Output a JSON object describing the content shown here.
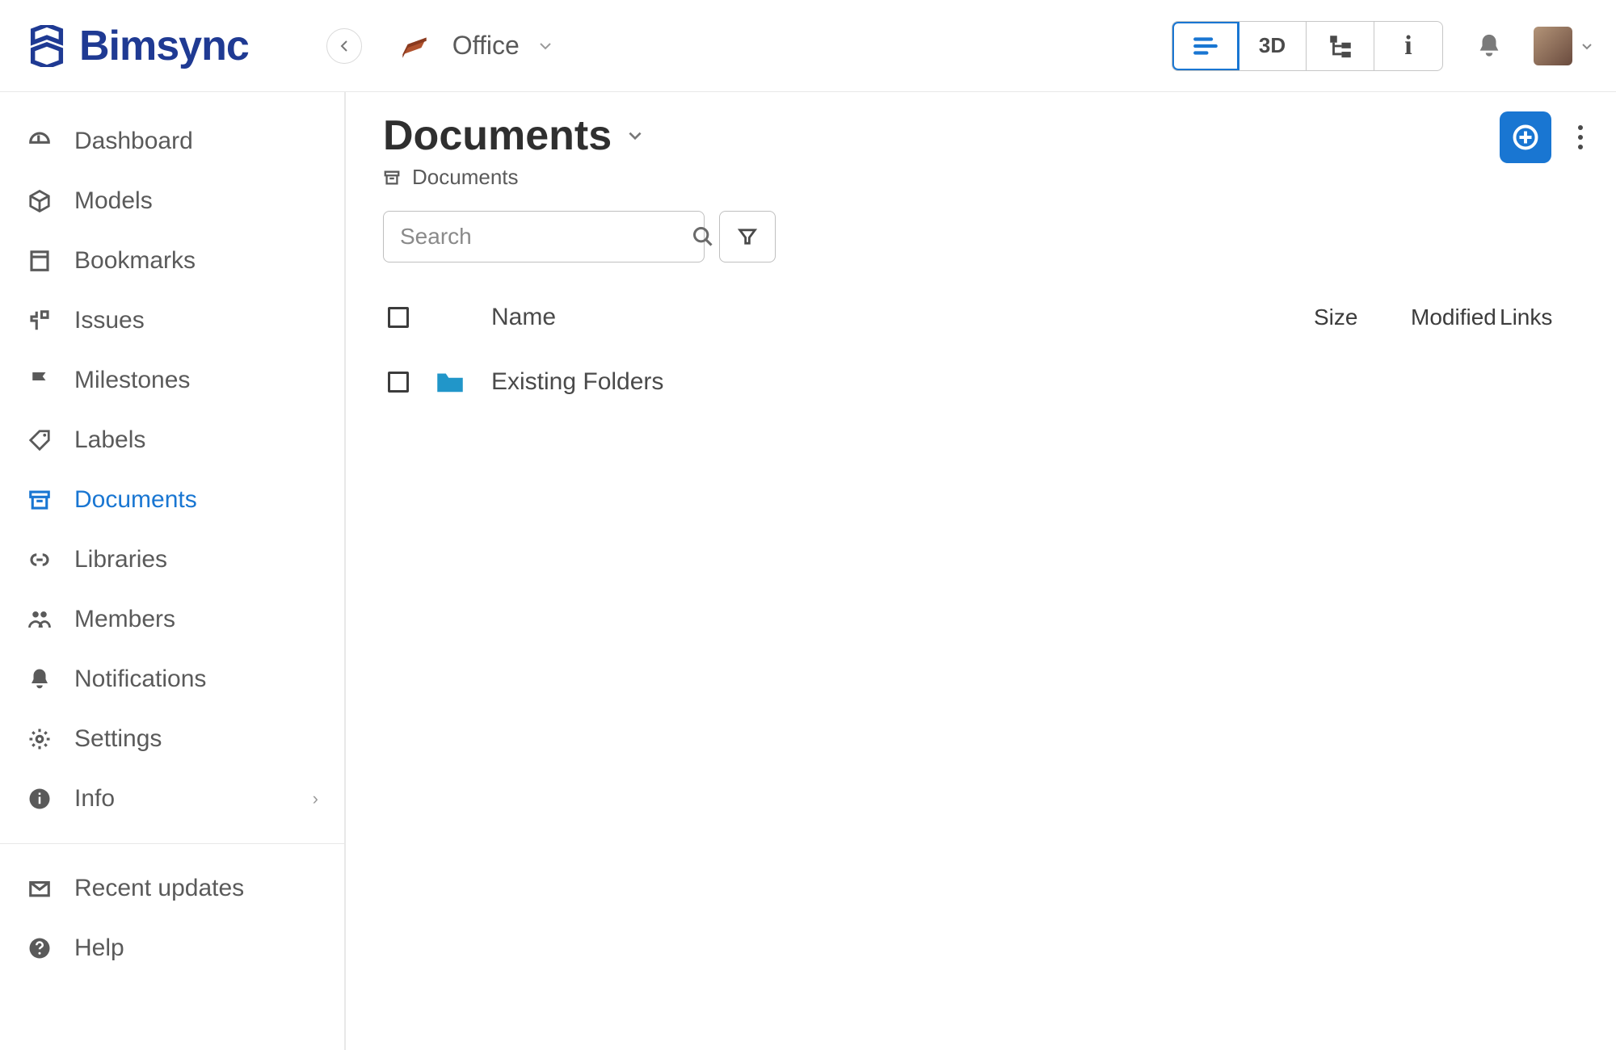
{
  "brand": "Bimsync",
  "project": {
    "name": "Office"
  },
  "view_tabs": {
    "list": "",
    "three_d": "3D",
    "tree": "",
    "info": "i"
  },
  "sidebar": {
    "items": [
      {
        "label": "Dashboard",
        "icon": "dashboard-icon"
      },
      {
        "label": "Models",
        "icon": "cube-icon"
      },
      {
        "label": "Bookmarks",
        "icon": "bookmark-icon"
      },
      {
        "label": "Issues",
        "icon": "issue-icon"
      },
      {
        "label": "Milestones",
        "icon": "flag-icon"
      },
      {
        "label": "Labels",
        "icon": "tag-icon"
      },
      {
        "label": "Documents",
        "icon": "archive-icon",
        "active": true
      },
      {
        "label": "Libraries",
        "icon": "link-icon"
      },
      {
        "label": "Members",
        "icon": "people-icon"
      },
      {
        "label": "Notifications",
        "icon": "bell-icon"
      },
      {
        "label": "Settings",
        "icon": "gear-icon"
      },
      {
        "label": "Info",
        "icon": "info-icon",
        "chev": true
      }
    ],
    "footer": [
      {
        "label": "Recent updates",
        "icon": "mail-icon"
      },
      {
        "label": "Help",
        "icon": "help-icon"
      }
    ]
  },
  "page": {
    "title": "Documents",
    "breadcrumb": "Documents"
  },
  "search": {
    "placeholder": "Search"
  },
  "table": {
    "headers": {
      "name": "Name",
      "size": "Size",
      "modified": "Modified",
      "links": "Links"
    },
    "rows": [
      {
        "name": "Existing Folders",
        "type": "folder"
      }
    ]
  }
}
